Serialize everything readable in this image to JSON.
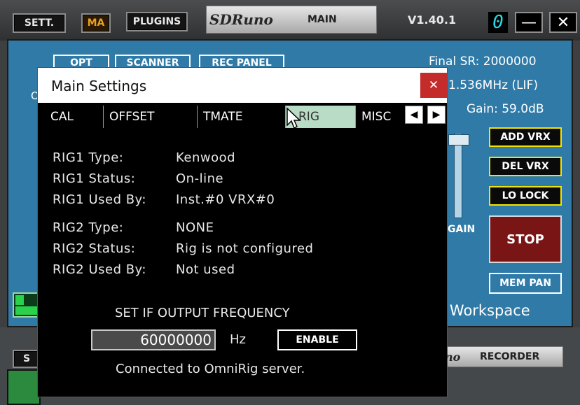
{
  "toolbar": {
    "sett_label": "SETT.",
    "ma_label": "MA",
    "plugins_label": "PLUGINS",
    "logo_text": "SDRuno",
    "main_label": "MAIN",
    "version": "V1.40.1",
    "digit": "0",
    "minimize_glyph": "—",
    "close_glyph": "✕"
  },
  "main_panel": {
    "opt_label": "OPT",
    "scanner_label": "SCANNER",
    "rec_panel_label": "REC PANEL",
    "final_sr": "Final SR: 2000000",
    "lif": "1.536MHz (LIF)",
    "gain": "Gain: 59.0dB",
    "add_vrx": "ADD VRX",
    "del_vrx": "DEL VRX",
    "lo_lock": "LO LOCK",
    "stop": "STOP",
    "mem_pan": "MEM PAN",
    "gain_label": "GAIN",
    "workspace": "t Workspace",
    "partial_s": "S",
    "partial_o": "O"
  },
  "bottom": {
    "partial_s": "S",
    "partial_no": "no",
    "recorder": "RECORDER"
  },
  "dialog": {
    "title": "Main Settings",
    "close_glyph": "✕",
    "tabs": [
      {
        "label": "CAL"
      },
      {
        "label": "OFFSET"
      },
      {
        "label": "TMATE"
      },
      {
        "label": "RIG"
      },
      {
        "label": "MISC"
      }
    ],
    "arrow_left": "◀",
    "arrow_right": "▶",
    "rig1": {
      "type_label": "RIG1 Type:",
      "type_value": "Kenwood",
      "status_label": "RIG1 Status:",
      "status_value": "On-line",
      "used_label": "RIG1 Used By:",
      "used_value": "Inst.#0 VRX#0"
    },
    "rig2": {
      "type_label": "RIG2 Type:",
      "type_value": "NONE",
      "status_label": "RIG2 Status:",
      "status_value": "Rig is not configured",
      "used_label": "RIG2 Used By:",
      "used_value": "Not used"
    },
    "set_if_label": "SET IF OUTPUT FREQUENCY",
    "frequency_value": "60000000",
    "hz_label": "Hz",
    "enable_label": "ENABLE",
    "status_message": "Connected to OmniRig server."
  },
  "colors": {
    "panel_blue": "#2f7aa7",
    "active_tab": "#b9dcc6",
    "stop_red": "#7a1515",
    "accent_yellow": "#f2e400",
    "ma_orange": "#e8a020",
    "digit_cyan": "#29d6e0"
  }
}
